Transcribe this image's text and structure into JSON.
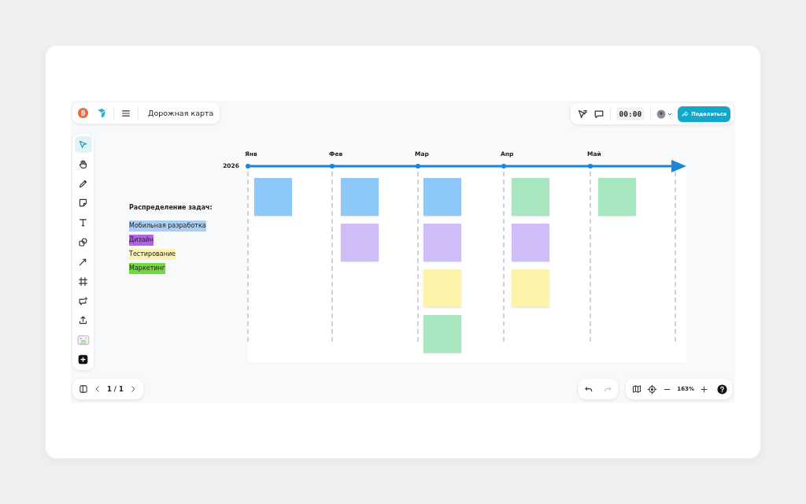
{
  "header": {
    "title": "Дорожная карта"
  },
  "timer": "00:00",
  "share_button": "Поделиться",
  "tools": [
    {
      "kind": "pointer",
      "selected": true
    },
    {
      "kind": "hand",
      "selected": false
    },
    {
      "kind": "pencil",
      "selected": false
    },
    {
      "kind": "sticky",
      "selected": false
    },
    {
      "kind": "text",
      "selected": false
    },
    {
      "kind": "shapes",
      "selected": false
    },
    {
      "kind": "arrow",
      "selected": false
    },
    {
      "kind": "frame",
      "selected": false
    },
    {
      "kind": "comment",
      "selected": false
    },
    {
      "kind": "upload",
      "selected": false
    },
    {
      "kind": "stickers",
      "selected": false
    },
    {
      "kind": "add",
      "selected": false
    }
  ],
  "legend": {
    "title": "Распределение задач:",
    "items": [
      {
        "label": "Мобильная разработка",
        "color": "#a9cff5"
      },
      {
        "label": "Дизайн",
        "color": "#b760ee"
      },
      {
        "label": "Тестирование",
        "color": "#fdf0b0"
      },
      {
        "label": "Маркетинг",
        "color": "#70d93c"
      }
    ]
  },
  "timeline": {
    "year": "2026",
    "months": [
      {
        "label": "Янв",
        "notes": [
          {
            "color": "#8ec8fb"
          }
        ]
      },
      {
        "label": "Фев",
        "notes": [
          {
            "color": "#8ec8fb"
          },
          {
            "color": "#cfbdf7"
          }
        ]
      },
      {
        "label": "Мар",
        "notes": [
          {
            "color": "#8ec8fb"
          },
          {
            "color": "#cfbdf7"
          },
          {
            "color": "#fdf3a9"
          },
          {
            "color": "#a8e6c0"
          }
        ]
      },
      {
        "label": "Апр",
        "notes": [
          {
            "color": "#a8e6c0"
          },
          {
            "color": "#cfbdf7"
          },
          {
            "color": "#fdf3a9"
          }
        ]
      },
      {
        "label": "Май",
        "notes": [
          {
            "color": "#a8e6c0"
          }
        ]
      }
    ]
  },
  "pager": {
    "page": "1 / 1"
  },
  "undo": {
    "disabled": false
  },
  "redo": {
    "disabled": true
  },
  "zoom": "163%"
}
